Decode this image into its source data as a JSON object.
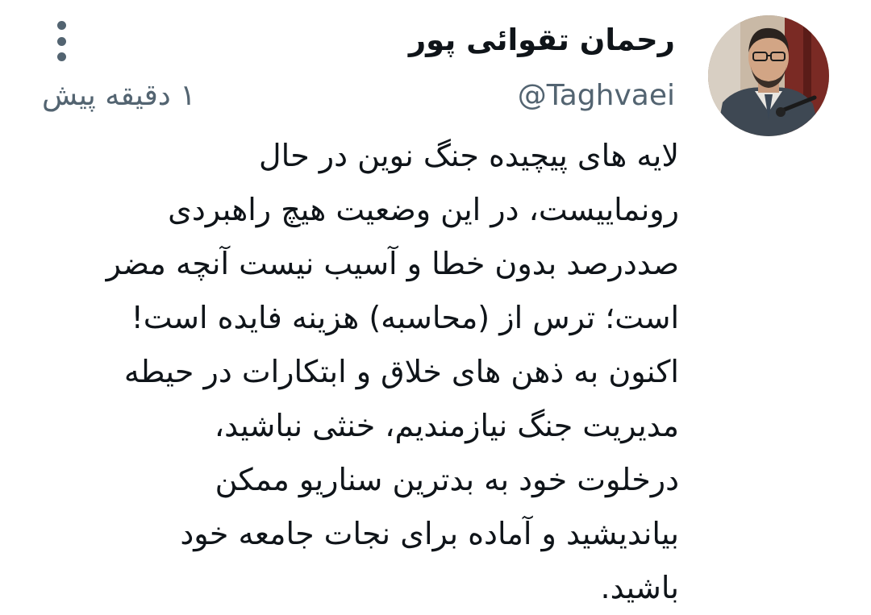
{
  "tweet": {
    "author": {
      "display_name": "رحمان تقوائی پور",
      "handle": "@Taghvaei"
    },
    "timestamp": "۱ دقیقه پیش",
    "more_icon": "more-vertical-icon",
    "body_lines": [
      "لایه های پیچیده جنگ نوین در حال",
      "رونماییست، در این وضعیت هیچ راهبردی",
      "صددرصد بدون خطا و آسیب نیست آنچه مضر",
      "است؛ ترس از (محاسبه) هزینه فایده است!",
      "اکنون به ذهن های خلاق و ابتکارات در حیطه",
      "مدیریت جنگ نیازمندیم، خنثی نباشید،",
      "درخلوت خود به بدترین سناریو ممکن",
      "بیاندیشید و آماده برای نجات جامعه خود",
      "باشید."
    ]
  },
  "colors": {
    "text_primary": "#0f1419",
    "text_secondary": "#536471",
    "background": "#ffffff"
  }
}
